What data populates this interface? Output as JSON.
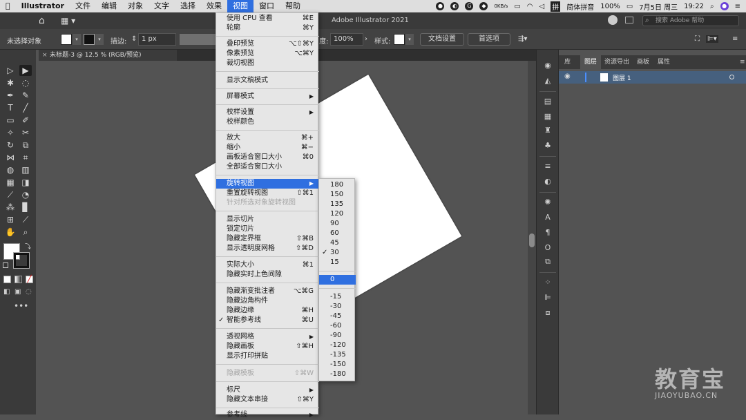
{
  "menubar": {
    "app": "Illustrator",
    "items": [
      "文件",
      "编辑",
      "对象",
      "文字",
      "选择",
      "效果",
      "视图",
      "窗口",
      "帮助"
    ],
    "active": "视图",
    "status": {
      "network": "0KB/s",
      "input_method": "简体拼音",
      "battery": "100%",
      "date": "7月5日 周三",
      "time": "19:22"
    }
  },
  "titlebar": {
    "app_title": "Adobe Illustrator 2021",
    "search_placeholder": "搜索 Adobe 帮助"
  },
  "controlbar": {
    "selection": "未选择对象",
    "stroke_label": "描边:",
    "stroke_value": "1 px",
    "opacity_label": "度:",
    "opacity_value": "100%",
    "style_label": "样式:",
    "doc_settings": "文档设置",
    "preferences": "首选项"
  },
  "document_tab": {
    "title": "未标题-3 @ 12.5 % (RGB/预览)"
  },
  "view_menu": {
    "items": [
      {
        "label": "使用 CPU 查看",
        "shortcut": "⌘E"
      },
      {
        "label": "轮廓",
        "shortcut": "⌘Y"
      },
      {
        "label": "叠印预览",
        "shortcut": "⌥⇧⌘Y"
      },
      {
        "label": "像素预览",
        "shortcut": "⌥⌘Y"
      },
      {
        "label": "裁切视图",
        "shortcut": ""
      },
      {
        "label": "显示文稿模式",
        "shortcut": ""
      },
      {
        "label": "屏幕模式",
        "shortcut": ""
      },
      {
        "label": "校样设置",
        "shortcut": ""
      },
      {
        "label": "校样颜色",
        "shortcut": ""
      },
      {
        "label": "放大",
        "shortcut": "⌘+"
      },
      {
        "label": "缩小",
        "shortcut": "⌘−"
      },
      {
        "label": "画板适合窗口大小",
        "shortcut": "⌘0"
      },
      {
        "label": "全部适合窗口大小",
        "shortcut": ""
      },
      {
        "label": "旋转视图",
        "shortcut": ""
      },
      {
        "label": "重置旋转视图",
        "shortcut": "⇧⌘1"
      },
      {
        "label": "针对所选对象旋转视图",
        "shortcut": ""
      },
      {
        "label": "显示切片",
        "shortcut": ""
      },
      {
        "label": "锁定切片",
        "shortcut": ""
      },
      {
        "label": "隐藏定界框",
        "shortcut": "⇧⌘B"
      },
      {
        "label": "显示透明度网格",
        "shortcut": "⇧⌘D"
      },
      {
        "label": "实际大小",
        "shortcut": "⌘1"
      },
      {
        "label": "隐藏实时上色间隙",
        "shortcut": ""
      },
      {
        "label": "隐藏渐变批注者",
        "shortcut": "⌥⌘G"
      },
      {
        "label": "隐藏边角构件",
        "shortcut": ""
      },
      {
        "label": "隐藏边缘",
        "shortcut": "⌘H"
      },
      {
        "label": "智能参考线",
        "shortcut": "⌘U"
      },
      {
        "label": "透视网格",
        "shortcut": ""
      },
      {
        "label": "隐藏画板",
        "shortcut": "⇧⌘H"
      },
      {
        "label": "显示打印拼贴",
        "shortcut": ""
      },
      {
        "label": "隐藏模板",
        "shortcut": "⇧⌘W"
      },
      {
        "label": "标尺",
        "shortcut": ""
      },
      {
        "label": "隐藏文本串接",
        "shortcut": "⇧⌘Y"
      },
      {
        "label": "参考线",
        "shortcut": ""
      }
    ]
  },
  "rotate_submenu": {
    "items": [
      "180",
      "150",
      "135",
      "120",
      "90",
      "60",
      "45",
      "30",
      "15",
      "0",
      "-15",
      "-30",
      "-45",
      "-60",
      "-90",
      "-120",
      "-135",
      "-150",
      "-180"
    ],
    "checked": "30",
    "highlighted": "0"
  },
  "panel": {
    "tabs": [
      "库",
      "图层",
      "资源导出",
      "画板",
      "属性"
    ],
    "active_tab": "图层",
    "layer_name": "图层 1"
  },
  "watermark": {
    "text": "教育宝",
    "sub": "JIAOYUBAO.CN"
  },
  "colors": {
    "menu_highlight": "#2f6fe0",
    "panel_bg": "#535353",
    "toolbar_bg": "#3a3a3a"
  }
}
